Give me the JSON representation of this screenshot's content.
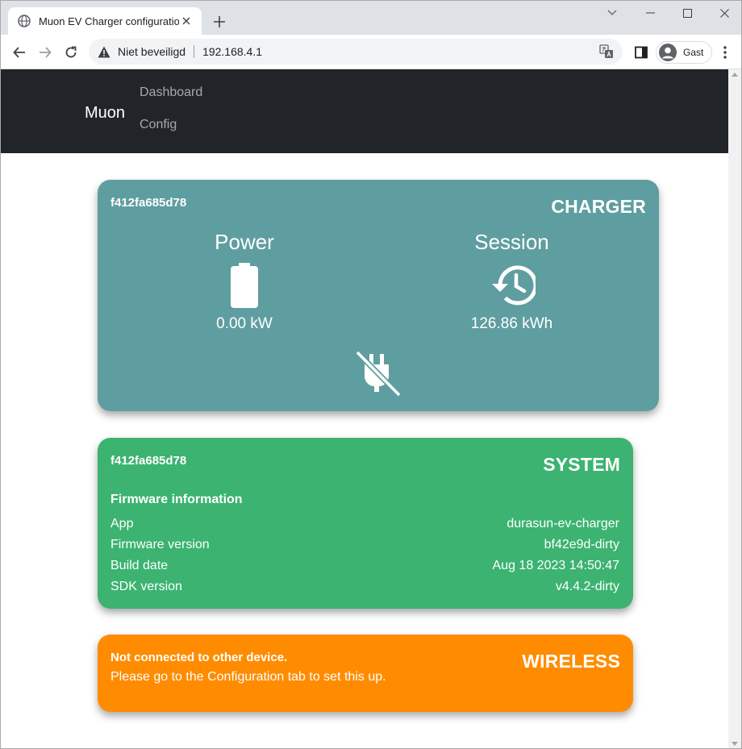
{
  "browser": {
    "tab_title": "Muon EV Charger configuration",
    "security_label": "Niet beveiligd",
    "url": "192.168.4.1",
    "profile_name": "Gast"
  },
  "nav": {
    "brand": "Muon",
    "links": [
      {
        "label": "Dashboard"
      },
      {
        "label": "Config"
      }
    ]
  },
  "charger": {
    "id": "f412fa685d78",
    "title": "CHARGER",
    "power_label": "Power",
    "power_value": "0.00 kW",
    "session_label": "Session",
    "session_value": "126.86 kWh",
    "plug_status_icon": "power-off-icon"
  },
  "system": {
    "id": "f412fa685d78",
    "title": "SYSTEM",
    "firmware_heading": "Firmware information",
    "rows": [
      {
        "label": "App",
        "value": "durasun-ev-charger"
      },
      {
        "label": "Firmware version",
        "value": "bf42e9d-dirty"
      },
      {
        "label": "Build date",
        "value": "Aug 18 2023 14:50:47"
      },
      {
        "label": "SDK version",
        "value": "v4.4.2-dirty"
      }
    ]
  },
  "wireless": {
    "title": "WIRELESS",
    "status": "Not connected to other device.",
    "hint": "Please go to the Configuration tab to set this up."
  },
  "colors": {
    "charger_card": "#5f9ea0",
    "system_card": "#3cb371",
    "wireless_card": "#ff8c00",
    "navbar": "#212529"
  }
}
